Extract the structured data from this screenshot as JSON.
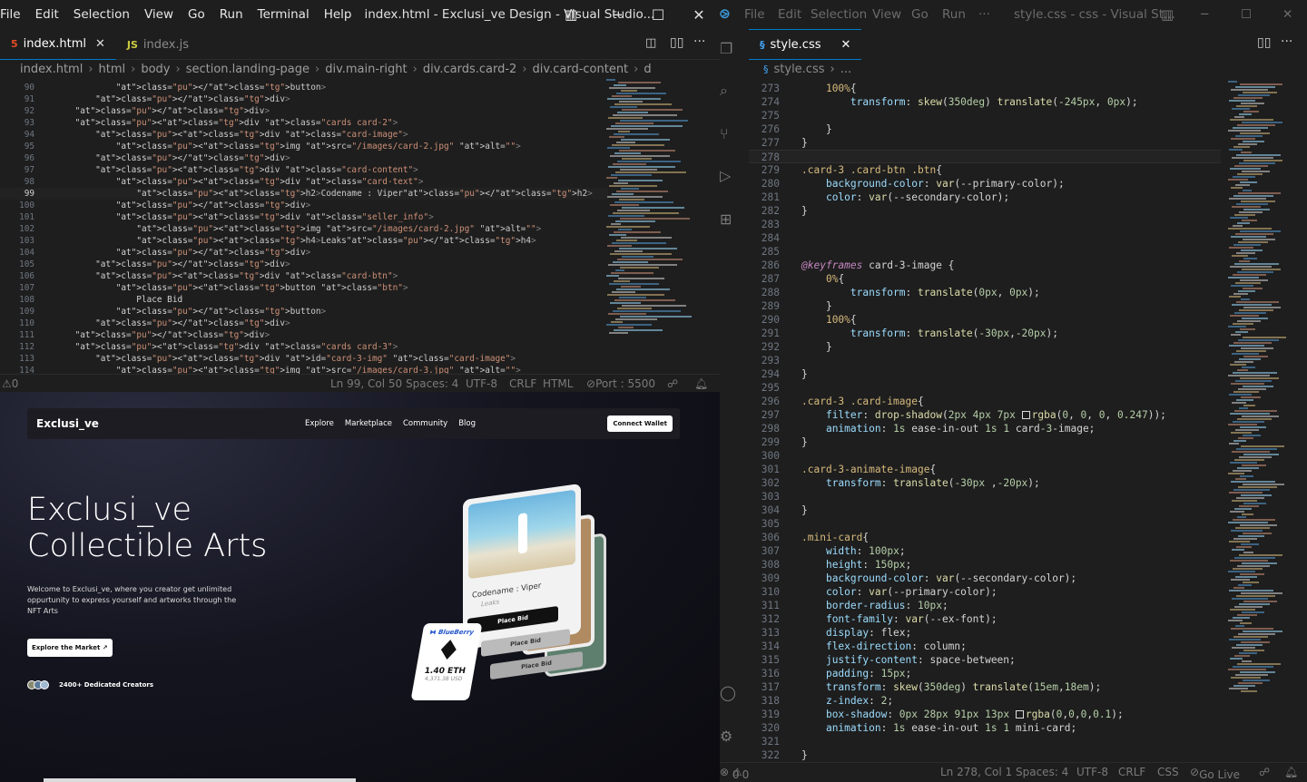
{
  "left": {
    "menu": [
      "File",
      "Edit",
      "Selection",
      "View",
      "Go",
      "Run",
      "Terminal",
      "Help"
    ],
    "title": "index.html - Exclusi_ve Design - Visual Studio...",
    "tabs": [
      {
        "label": "index.html",
        "icon": "html-file-icon"
      },
      {
        "label": "index.js",
        "icon": "js-file-icon"
      }
    ],
    "breadcrumb": [
      "index.html",
      "html",
      "body",
      "section.landing-page",
      "div.main-right",
      "div.cards.card-2",
      "div.card-content",
      "d"
    ],
    "code": [
      {
        "n": "90",
        "t": "            </button>"
      },
      {
        "n": "91",
        "t": "        </div>"
      },
      {
        "n": "92",
        "t": "    </div>"
      },
      {
        "n": "93",
        "t": "    <div class=\"cards card-2\">"
      },
      {
        "n": "94",
        "t": "        <div class=\"card-image\">"
      },
      {
        "n": "95",
        "t": "            <img src=\"/images/card-2.jpg\" alt=\"\">"
      },
      {
        "n": "96",
        "t": "        </div>"
      },
      {
        "n": "97",
        "t": "        <div class=\"card-content\">"
      },
      {
        "n": "98",
        "t": "            <div class=\"card-text\">"
      },
      {
        "n": "99",
        "t": "                <h2>Codename : Viper</h2>"
      },
      {
        "n": "100",
        "t": "            </div>"
      },
      {
        "n": "101",
        "t": "            <div class=\"seller_info\">"
      },
      {
        "n": "102",
        "t": "                <img src=\"/images/card-2.jpg\" alt=\"\">"
      },
      {
        "n": "103",
        "t": "                <h4>Leaks</h4>"
      },
      {
        "n": "104",
        "t": "            </div>"
      },
      {
        "n": "105",
        "t": "        </div>"
      },
      {
        "n": "106",
        "t": "        <div class=\"card-btn\">"
      },
      {
        "n": "107",
        "t": "            <button class=\"btn\">"
      },
      {
        "n": "108",
        "t": "                Place Bid"
      },
      {
        "n": "109",
        "t": "            </button>"
      },
      {
        "n": "110",
        "t": "        </div>"
      },
      {
        "n": "111",
        "t": "    </div>"
      },
      {
        "n": "112",
        "t": "    <div class=\"cards card-3\">"
      },
      {
        "n": "113",
        "t": "        <div id=\"card-3-img\" class=\"card-image\">"
      },
      {
        "n": "114",
        "t": "            <img src=\"/images/card-3.jpg\" alt=\"\">"
      }
    ],
    "status": {
      "problems": "0",
      "pos": "Ln 99, Col 50",
      "spaces": "Spaces: 4",
      "enc": "UTF-8",
      "eol": "CRLF",
      "lang": "HTML",
      "port": "Port : 5500"
    }
  },
  "preview": {
    "brand": "Exclusi_ve",
    "nav": [
      "Explore",
      "Marketplace",
      "Community",
      "Blog"
    ],
    "wallet": "Connect Wallet",
    "hero1": "Exclusi_ve",
    "hero2": "Collectible Arts",
    "lead": "Welcome to Exclusi_ve, where you creator get unlimited oppurtunity to express yourself and artworks through the NFT Arts",
    "explore": "Explore the Market ↗",
    "creators": "2400+ Dedicated Creators",
    "card_title": "Codename : Viper",
    "card_seller": "Leaks",
    "bid": "Place Bid",
    "mini_brand": "BlueBerry",
    "mini_eth": "1.40 ETH",
    "mini_usd": "4,371.38 USD"
  },
  "right": {
    "menu": [
      "File",
      "Edit",
      "Selection",
      "View",
      "Go",
      "Run",
      "···"
    ],
    "title": "style.css - css - Visual St...",
    "tab": "style.css",
    "breadcrumb": [
      "style.css",
      "..."
    ],
    "status": {
      "problems": "0",
      "warnings": "0",
      "pos": "Ln 278, Col 1",
      "spaces": "Spaces: 4",
      "enc": "UTF-8",
      "eol": "CRLF",
      "lang": "CSS",
      "live": "Go Live"
    }
  }
}
